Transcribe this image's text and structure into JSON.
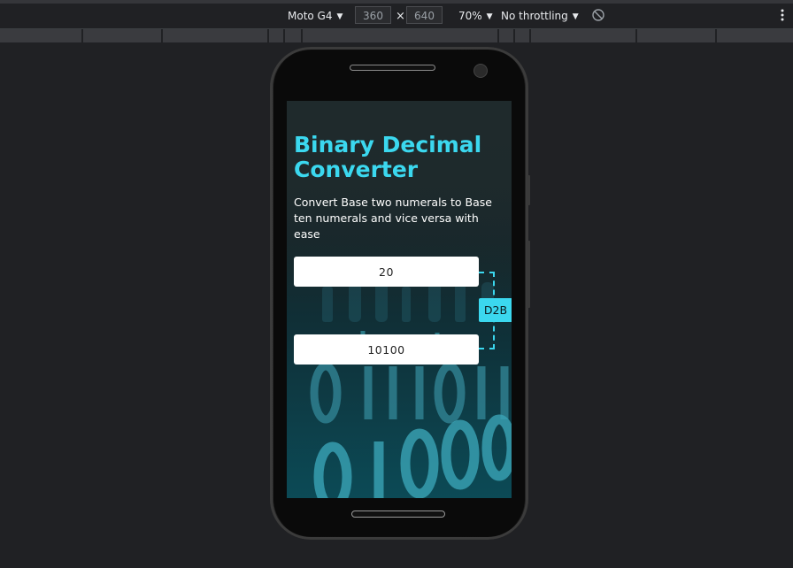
{
  "devtools": {
    "device": "Moto G4",
    "width": "360",
    "times": "×",
    "height": "640",
    "zoom": "70%",
    "throttling": "No throttling"
  },
  "app": {
    "title": "Binary Decimal Converter",
    "subtitle": "Convert Base two numerals to Base ten numerals and vice versa with ease",
    "decimal_value": "20",
    "binary_value": "10100",
    "mode_label": "D2B"
  },
  "colors": {
    "accent": "#3bd8ef",
    "page_bg": "#202124"
  }
}
